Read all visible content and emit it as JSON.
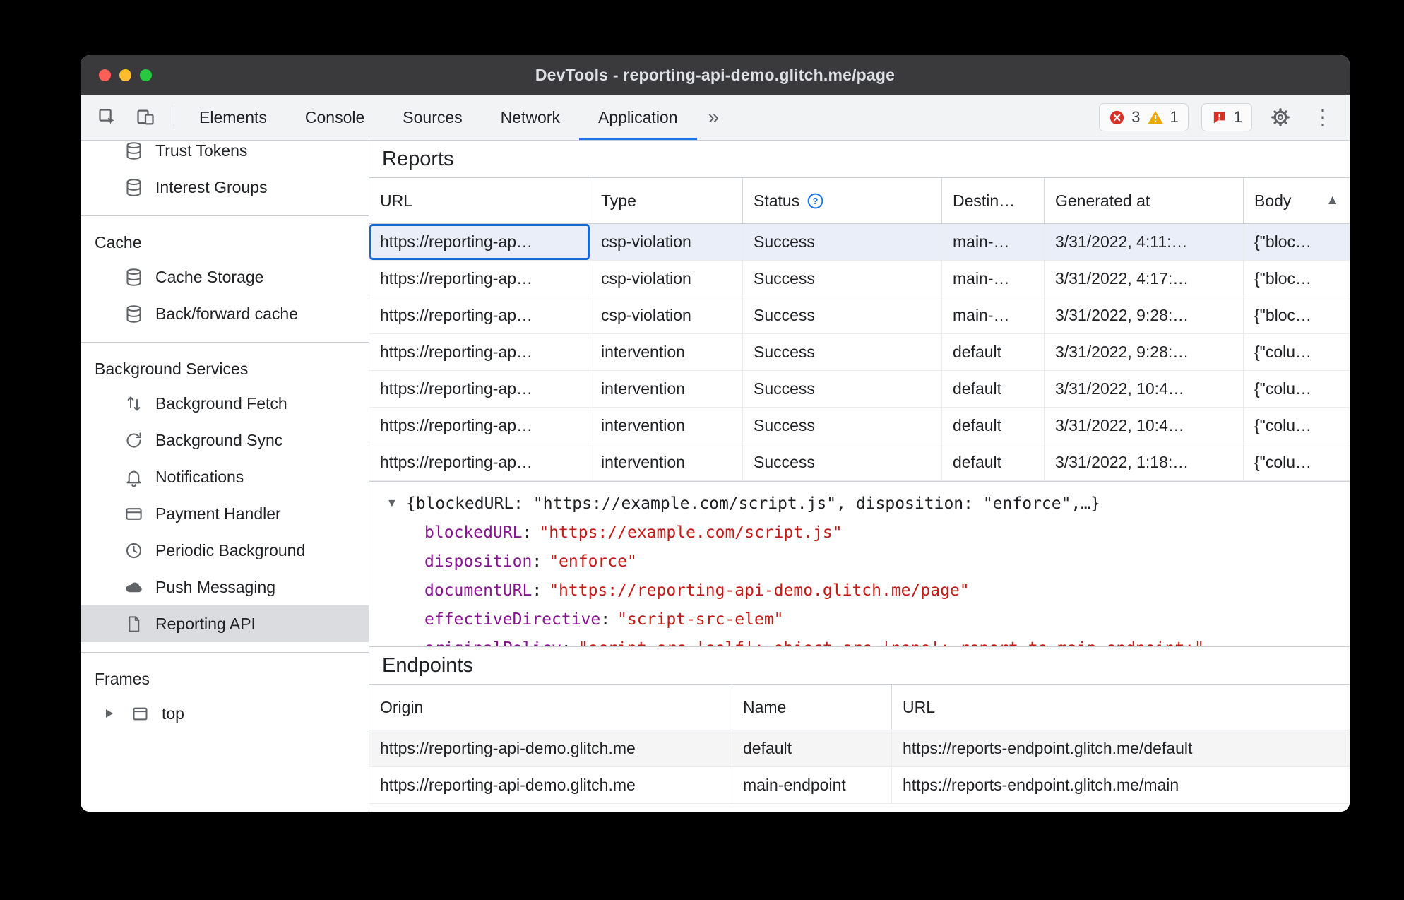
{
  "window": {
    "title": "DevTools - reporting-api-demo.glitch.me/page"
  },
  "toolbar": {
    "tabs": [
      {
        "label": "Elements"
      },
      {
        "label": "Console"
      },
      {
        "label": "Sources"
      },
      {
        "label": "Network"
      },
      {
        "label": "Application"
      }
    ],
    "active_tab": "Application",
    "more_tabs_glyph": "»",
    "badges": {
      "errors": "3",
      "warnings": "1",
      "issues": "1"
    }
  },
  "sidebar": {
    "sections": [
      {
        "title": "",
        "items": [
          {
            "label": "Trust Tokens",
            "icon": "database-icon"
          },
          {
            "label": "Interest Groups",
            "icon": "database-icon"
          }
        ]
      },
      {
        "title": "Cache",
        "items": [
          {
            "label": "Cache Storage",
            "icon": "database-icon"
          },
          {
            "label": "Back/forward cache",
            "icon": "database-icon"
          }
        ]
      },
      {
        "title": "Background Services",
        "items": [
          {
            "label": "Background Fetch",
            "icon": "background-fetch-icon"
          },
          {
            "label": "Background Sync",
            "icon": "background-sync-icon"
          },
          {
            "label": "Notifications",
            "icon": "bell-icon"
          },
          {
            "label": "Payment Handler",
            "icon": "payment-card-icon"
          },
          {
            "label": "Periodic Background",
            "icon": "clock-icon"
          },
          {
            "label": "Push Messaging",
            "icon": "cloud-icon"
          },
          {
            "label": "Reporting API",
            "icon": "file-icon",
            "selected": true
          }
        ]
      },
      {
        "title": "Frames",
        "items": [
          {
            "label": "top",
            "icon": "frame-icon",
            "expandable": true
          }
        ]
      }
    ]
  },
  "reports": {
    "title": "Reports",
    "columns": {
      "url": "URL",
      "type": "Type",
      "status": "Status",
      "destination": "Destin…",
      "generated": "Generated at",
      "body": "Body"
    },
    "sort_icon": "▲",
    "rows": [
      {
        "url": "https://reporting-ap…",
        "type": "csp-violation",
        "status": "Success",
        "destination": "main-…",
        "generated": "3/31/2022, 4:11:…",
        "body": "{\"bloc…"
      },
      {
        "url": "https://reporting-ap…",
        "type": "csp-violation",
        "status": "Success",
        "destination": "main-…",
        "generated": "3/31/2022, 4:17:…",
        "body": "{\"bloc…"
      },
      {
        "url": "https://reporting-ap…",
        "type": "csp-violation",
        "status": "Success",
        "destination": "main-…",
        "generated": "3/31/2022, 9:28:…",
        "body": "{\"bloc…"
      },
      {
        "url": "https://reporting-ap…",
        "type": "intervention",
        "status": "Success",
        "destination": "default",
        "generated": "3/31/2022, 9:28:…",
        "body": "{\"colu…"
      },
      {
        "url": "https://reporting-ap…",
        "type": "intervention",
        "status": "Success",
        "destination": "default",
        "generated": "3/31/2022, 10:4…",
        "body": "{\"colu…"
      },
      {
        "url": "https://reporting-ap…",
        "type": "intervention",
        "status": "Success",
        "destination": "default",
        "generated": "3/31/2022, 10:4…",
        "body": "{\"colu…"
      },
      {
        "url": "https://reporting-ap…",
        "type": "intervention",
        "status": "Success",
        "destination": "default",
        "generated": "3/31/2022, 1:18:…",
        "body": "{\"colu…"
      }
    ]
  },
  "preview": {
    "expander": "▼",
    "summary": "{blockedURL: \"https://example.com/script.js\", disposition: \"enforce\",…}",
    "properties": [
      {
        "key": "blockedURL",
        "value": "\"https://example.com/script.js\""
      },
      {
        "key": "disposition",
        "value": "\"enforce\""
      },
      {
        "key": "documentURL",
        "value": "\"https://reporting-api-demo.glitch.me/page\""
      },
      {
        "key": "effectiveDirective",
        "value": "\"script-src-elem\""
      },
      {
        "key": "originalPolicy",
        "value": "\"script-src 'self'; object-src 'none'; report-to main-endpoint;\""
      }
    ]
  },
  "endpoints": {
    "title": "Endpoints",
    "columns": {
      "origin": "Origin",
      "name": "Name",
      "url": "URL"
    },
    "rows": [
      {
        "origin": "https://reporting-api-demo.glitch.me",
        "name": "default",
        "url": "https://reports-endpoint.glitch.me/default"
      },
      {
        "origin": "https://reporting-api-demo.glitch.me",
        "name": "main-endpoint",
        "url": "https://reports-endpoint.glitch.me/main"
      }
    ]
  },
  "colors": {
    "accent": "#1a73e8",
    "error": "#d93025",
    "warning": "#f2a600",
    "sidebar_selection": "#dadce0",
    "selected_row": "#e9eef8"
  }
}
